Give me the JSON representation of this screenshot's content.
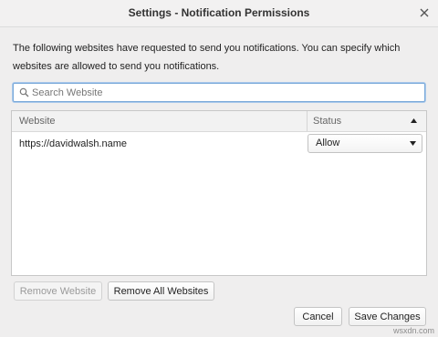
{
  "window": {
    "title": "Settings - Notification Permissions",
    "close_icon": "close-icon"
  },
  "description": "The following websites have requested to send you notifications. You can specify which websites are allowed to send you notifications.",
  "search": {
    "placeholder": "Search Website",
    "value": "",
    "icon": "search-icon"
  },
  "table": {
    "columns": {
      "website": "Website",
      "status": "Status"
    },
    "sort_icon": "triangle-up-icon",
    "rows": [
      {
        "website": "https://davidwalsh.name",
        "status": "Allow"
      }
    ]
  },
  "buttons": {
    "remove_website": "Remove Website",
    "remove_all": "Remove All Websites",
    "cancel": "Cancel",
    "save": "Save Changes"
  },
  "watermark": "wsxdn.com",
  "colors": {
    "focus_border": "#7aa9d9",
    "window_bg": "#efeeee"
  }
}
